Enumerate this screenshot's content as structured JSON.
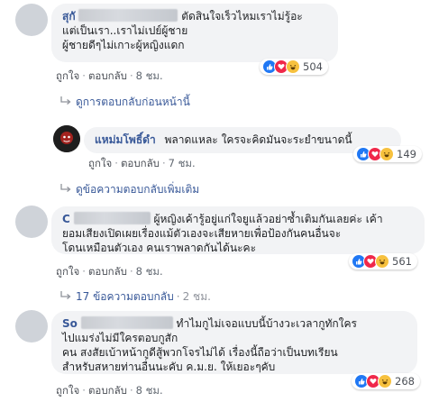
{
  "comments": [
    {
      "name": "สุกั",
      "lines": [
        "ตัดสินใจเร็วไหมเราไม่รู้อะ",
        "แต่เป็นเรา..เราไม่เปย์ผู้ชาย",
        "ผู้ชายดีๆไม่เกาะผู้หญิงแดก"
      ],
      "like": "ถูกใจ",
      "reply": "ตอบกลับ",
      "time": "8 ชม.",
      "reaction_count": "504"
    },
    {
      "name": "แหม่มโพธิ์ดำ",
      "text": "พลาดแหละ ใครจะคิดมันจะระยำขนาดนี้",
      "like": "ถูกใจ",
      "reply": "ตอบกลับ",
      "time": "7 ชม.",
      "reaction_count": "149"
    },
    {
      "name": "C",
      "lines": [
        "ผู้หญิงเค้ารู้อยู่แก่ใจยูแล้วอย่าซ้ำเติมกันเลยค่ะ เค้า",
        "ยอมเสียงเปิดเผยเรื่องแม้ตัวเองจะเสียหายเพื่อป้องกันคนอื่นจะ",
        "โดนเหมือนตัวเอง คนเราพลาดกันได้นะคะ"
      ],
      "like": "ถูกใจ",
      "reply": "ตอบกลับ",
      "time": "8 ชม.",
      "reaction_count": "561"
    },
    {
      "name": "So",
      "lines": [
        "ทำไมกูไม่เจอแบบนี้บ้างวะเวลากูทักใคร",
        "ไปแมร่งไม่มีใครตอบกูสัก",
        "คน สงสัยเบ้าหน้ากูดีสู้พวกโจรไม่ได้ เรื่องนี้ถือว่าเป็นบทเรียน",
        "สำหรับสหายท่านอื่นนะคับ ค.ม.ย. ให้เยอะๆคับ"
      ],
      "like": "ถูกใจ",
      "reply": "ตอบกลับ",
      "time": "8 ชม.",
      "reaction_count": "268"
    }
  ],
  "prev_replies_link": "ดูการตอบกลับก่อนหน้านี้",
  "more_replies_link": "ดูข้อความตอบกลับเพิ่มเติม",
  "replies_count_link": "17 ข้อความตอบกลับ",
  "replies_count_time": "2 ชม.",
  "colors": {
    "link": "#385898",
    "bubble": "#f2f3f5",
    "like": "#2078f4",
    "love": "#f0284a",
    "haha": "#f7c13e"
  }
}
